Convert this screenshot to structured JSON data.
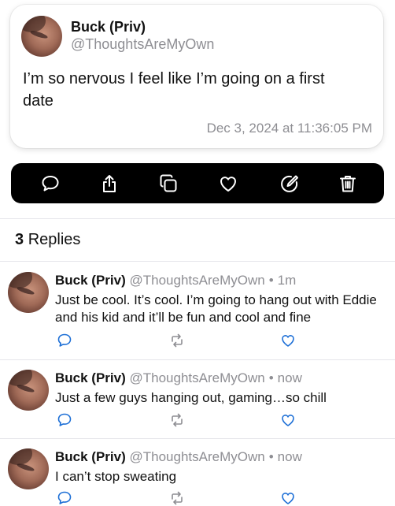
{
  "post": {
    "author_name": "Buck (Priv)",
    "author_handle": "@ThoughtsAreMyOwn",
    "text": "I’m so nervous I feel like I’m going on a first date",
    "timestamp": "Dec 3, 2024 at 11:36:05 PM"
  },
  "toolbar": {
    "icons": [
      "comment-icon",
      "share-icon",
      "copy-icon",
      "like-icon",
      "edit-icon",
      "trash-icon"
    ],
    "background": "#000000",
    "icon_color": "#ffffff"
  },
  "replies_header": {
    "count": "3",
    "label": "Replies"
  },
  "replies": [
    {
      "name": "Buck (Priv)",
      "handle": "@ThoughtsAreMyOwn",
      "separator": "•",
      "time": "1m",
      "text": "Just be cool. It’s cool. I’m going to hang out with Eddie and his kid and it’ll be fun and cool and fine"
    },
    {
      "name": "Buck (Priv)",
      "handle": "@ThoughtsAreMyOwn",
      "separator": "•",
      "time": "now",
      "text": "Just a few guys hanging out, gaming…so chill"
    },
    {
      "name": "Buck (Priv)",
      "handle": "@ThoughtsAreMyOwn",
      "separator": "•",
      "time": "now",
      "text": "I can’t stop sweating"
    }
  ],
  "colors": {
    "secondary_text": "#8e8e93",
    "divider": "#e5e5ea",
    "icon_blue": "#1d6fd6"
  }
}
